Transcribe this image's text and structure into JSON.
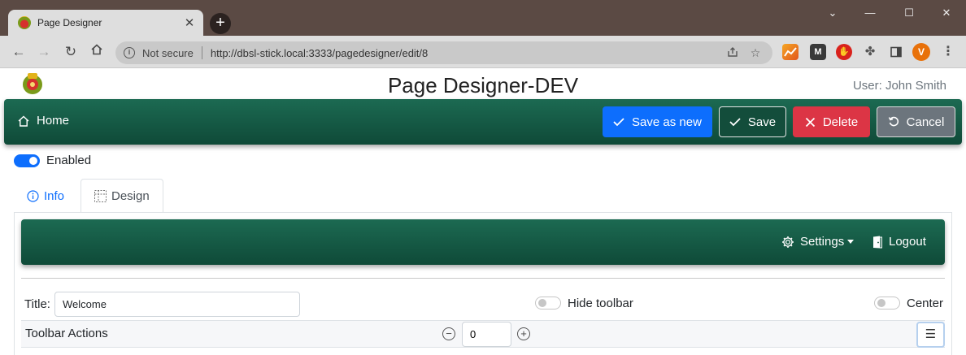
{
  "browser": {
    "tab_title": "Page Designer",
    "tab_close": "✕",
    "new_tab": "+",
    "window_controls": {
      "minimize": "—",
      "maximize": "☐",
      "close": "✕",
      "menu": "⌄"
    },
    "security_label": "Not secure",
    "url": "http://dbsl-stick.local:3333/pagedesigner/edit/8",
    "profile_initial": "V",
    "extensions": [
      "chart-extension-icon",
      "m-extension-icon",
      "hand-extension-icon",
      "puzzle-icon",
      "sidebar-icon"
    ]
  },
  "header": {
    "title": "Page Designer-DEV",
    "user": "User: John Smith"
  },
  "main_nav": {
    "home_label": "Home",
    "buttons": {
      "save_as_new": "Save as new",
      "save": "Save",
      "delete": "Delete",
      "cancel": "Cancel"
    }
  },
  "enabled": {
    "label": "Enabled",
    "on": true
  },
  "tabs": [
    {
      "label": "Info",
      "active": false
    },
    {
      "label": "Design",
      "active": true
    }
  ],
  "inner_nav": {
    "settings_label": "Settings",
    "logout_label": "Logout"
  },
  "form": {
    "title_label": "Title:",
    "title_value": "Welcome",
    "hide_toolbar_label": "Hide toolbar",
    "hide_toolbar_on": false,
    "center_label": "Center",
    "center_on": false,
    "toolbar_actions_label": "Toolbar Actions",
    "toolbar_actions_value": "0",
    "menu_glyph": "☰"
  },
  "colors": {
    "nav_green": "#0f4a38",
    "primary": "#0d6efd",
    "danger": "#dc3545",
    "secondary": "#6c757d"
  }
}
